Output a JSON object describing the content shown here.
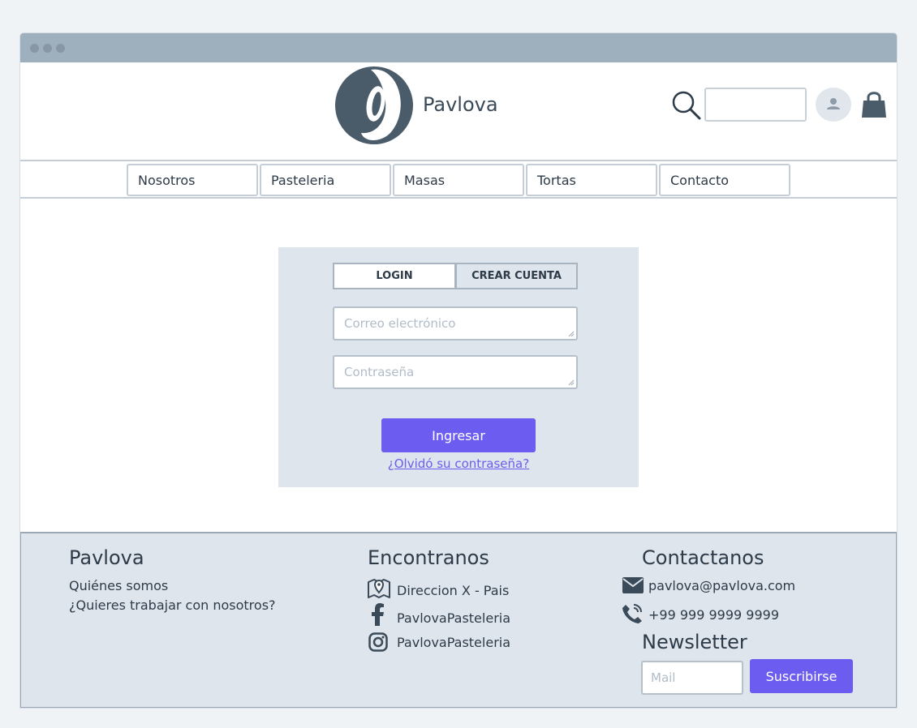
{
  "header": {
    "brand": "Pavlova",
    "search_placeholder": ""
  },
  "nav": {
    "items": [
      "Nosotros",
      "Pasteleria",
      "Masas",
      "Tortas",
      "Contacto"
    ]
  },
  "login": {
    "tabs": {
      "login": "LOGIN",
      "create": "CREAR CUENTA"
    },
    "active_tab": "login",
    "email_placeholder": "Correo electrónico",
    "password_placeholder": "Contraseña",
    "submit_label": "Ingresar",
    "forgot_label": "¿Olvidó su contraseña?"
  },
  "footer": {
    "about": {
      "title": "Pavlova",
      "links": [
        "Quiénes somos",
        "¿Quieres trabajar con nosotros?"
      ]
    },
    "find": {
      "title": "Encontranos",
      "address": "Direccion X - Pais",
      "facebook": "PavlovaPasteleria",
      "instagram": "PavlovaPasteleria"
    },
    "contact": {
      "title": "Contactanos",
      "email": "pavlova@pavlova.com",
      "phone": "+99 999 9999 9999"
    },
    "newsletter": {
      "title": "Newsletter",
      "placeholder": "Mail",
      "button_label": "Suscribirse"
    }
  },
  "colors": {
    "accent": "#6c5cf0",
    "titlebar": "#9eafbd",
    "panel_bg": "#dfe5ed",
    "logo": "#4a5b6a"
  },
  "icons": [
    "logo-icon",
    "search-icon",
    "user-icon",
    "shopping-bag-icon",
    "map-pin-icon",
    "facebook-icon",
    "instagram-icon",
    "envelope-icon",
    "phone-icon"
  ]
}
